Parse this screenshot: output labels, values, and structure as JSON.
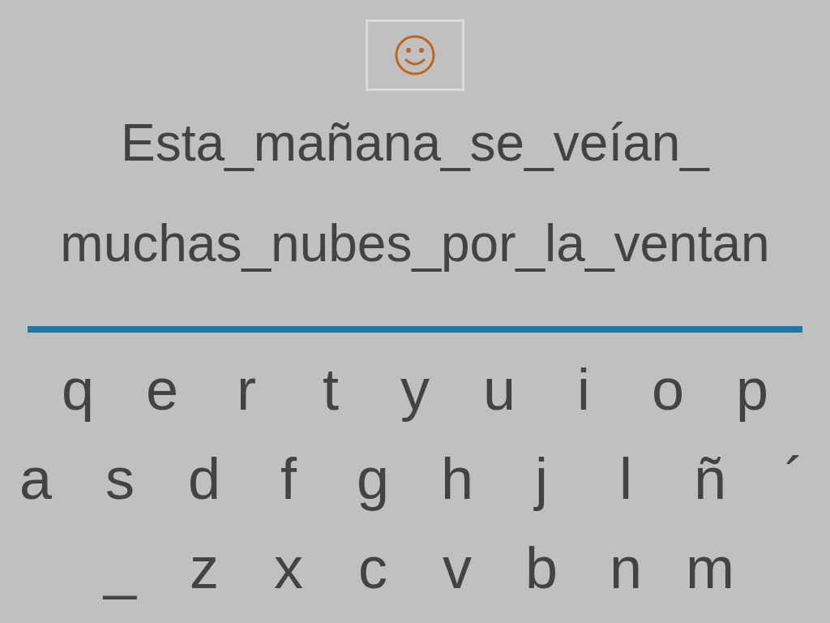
{
  "feedback": {
    "kind": "happy"
  },
  "sentence": [
    "Esta_mañana_se_veían_",
    "muchas_nubes_por_la_ventan"
  ],
  "keyboard": [
    [
      "q",
      "e",
      "r",
      "t",
      "y",
      "u",
      "i",
      "o",
      "p"
    ],
    [
      "a",
      "s",
      "d",
      "f",
      "g",
      "h",
      "j",
      "l",
      "ñ",
      "´"
    ],
    [
      "_",
      "z",
      "x",
      "c",
      "v",
      "b",
      "n",
      "m"
    ]
  ]
}
